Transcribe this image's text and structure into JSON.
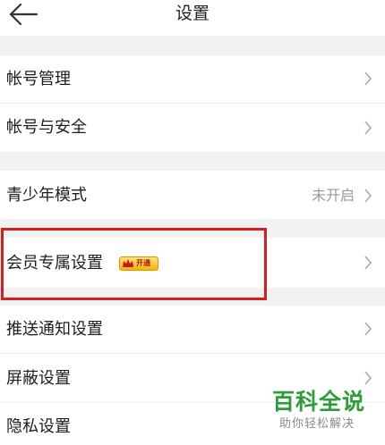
{
  "header": {
    "title": "设置",
    "back_icon": "arrow-left-icon"
  },
  "sections": {
    "account": {
      "manage_label": "帐号管理",
      "security_label": "帐号与安全"
    },
    "youth": {
      "label": "青少年模式",
      "value": "未开启"
    },
    "member": {
      "label": "会员专属设置",
      "badge_text": "开通",
      "badge_icon": "crown-icon"
    },
    "general": {
      "push_label": "推送通知设置",
      "block_label": "屏蔽设置",
      "privacy_label": "隐私设置"
    }
  },
  "chevron_icon": "chevron-right-icon",
  "watermark": {
    "title": "百科全说",
    "subtitle": "助你轻松解决"
  },
  "colors": {
    "highlight": "#d81e1e",
    "watermark_green": "#2d9d3a",
    "badge_gold": "#f2b705"
  }
}
